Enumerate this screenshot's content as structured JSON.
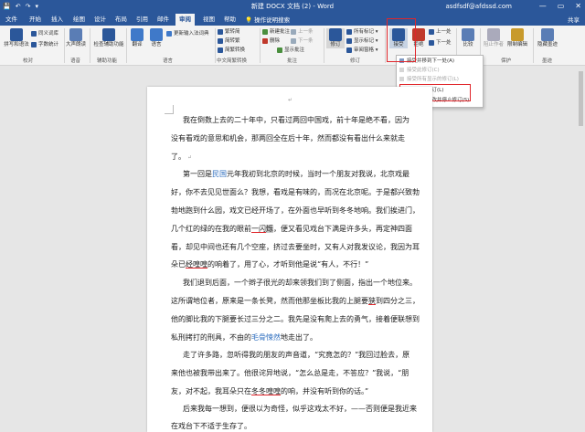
{
  "title_bar": {
    "quick_access": [
      "💾",
      "↶",
      "↷",
      "▾"
    ],
    "doc_title": "新建 DOCX 文档 (2) - Word",
    "user": "asdfsdf@afdssd.com",
    "minimize": "—",
    "restore": "▭",
    "close": "✕"
  },
  "tabs": [
    "文件",
    "开始",
    "插入",
    "绘图",
    "设计",
    "布局",
    "引用",
    "邮件",
    "审阅",
    "视图",
    "帮助"
  ],
  "tell_me": "操作说明搜索",
  "share": "共享",
  "ribbon": {
    "proofing": {
      "spell": "拼写和语法",
      "thesaurus": "同义词库",
      "wordcount": "字数统计",
      "label": "校对"
    },
    "speech": {
      "read_aloud": "大声朗读",
      "label": "语音"
    },
    "accessibility": {
      "check": "检查辅助功能",
      "label": "辅助功能"
    },
    "language": {
      "translate": "翻译",
      "language": "语言",
      "update_ime": "更新输入法词典",
      "label": "语言"
    },
    "chinese": {
      "t2s": "繁转简",
      "s2t": "简转繁",
      "convert": "简繁转换",
      "label": "中文简繁转换"
    },
    "comments": {
      "new": "新建批注",
      "delete": "删除",
      "prev": "上一条",
      "next": "下一条",
      "show": "显示批注",
      "label": "批注"
    },
    "tracking": {
      "track": "修订",
      "all_markup": "所有标记",
      "show_markup": "显示标记",
      "pane": "审阅窗格",
      "label": "修订"
    },
    "changes": {
      "accept": "接受",
      "reject": "拒绝",
      "previous": "上一处",
      "next": "下一处"
    },
    "compare": {
      "compare": "比较",
      "label": "比较"
    },
    "protect": {
      "block": "阻止作者",
      "restrict": "限制编辑",
      "label": "保护"
    },
    "ink": {
      "hide": "隐藏墨迹",
      "label": "墨迹"
    }
  },
  "accept_menu": {
    "items": [
      "接受并移到下一处(A)",
      "接受此修订(C)",
      "接受所有显示的修订(L)",
      "接受所有修订(L)",
      "接受所有更改并停止修订(S)"
    ]
  },
  "document": {
    "lines": [
      {
        "segments": [
          {
            "t": "我在倒数上去的二十年中，只看过两回中国戏，前十年是绝不看，因为"
          }
        ]
      },
      {
        "segments": [
          {
            "t": "没有看戏的意思和机会，那两回全在后十年，然而都没有看出什么来就走"
          }
        ]
      },
      {
        "segments": [
          {
            "t": "了。"
          }
        ]
      },
      {
        "segments": [
          {
            "t": "第一回是"
          },
          {
            "t": "民国",
            "c": "blue"
          },
          {
            "t": "元年我初到北京的时候，当时一个朋友对我说，北京戏最"
          }
        ]
      },
      {
        "segments": [
          {
            "t": "好，你不去见见世面么？我想，看戏是有味的，而况在北京呢。于是都兴致勃"
          }
        ]
      },
      {
        "segments": [
          {
            "t": "勃地跑到什么园，戏文已经开场了，在外面也早听到冬冬地响。我们挨进门，"
          }
        ]
      },
      {
        "segments": [
          {
            "t": "几个红的绿的在我的眼前"
          },
          {
            "t": "一闪",
            "c": "red"
          },
          {
            "t": "烁",
            "c": "gray"
          },
          {
            "t": "，便又看见戏台下满是许多头，再定神四面"
          }
        ]
      },
      {
        "segments": [
          {
            "t": "看，却见中间也还有几个空座，挤过去要坐时，又有人对我发议论，我因为耳"
          }
        ]
      },
      {
        "segments": [
          {
            "t": "朵已"
          },
          {
            "t": "经喤喤",
            "c": "red"
          },
          {
            "t": "的响着了，用了心，才听到他是说“有人，不行！”"
          }
        ]
      },
      {
        "segments": [
          {
            "t": "我们退到后面，一个辫子很光的却来领我们到了侧面，指出一个地位来。"
          }
        ]
      },
      {
        "segments": [
          {
            "t": "这所谓地位者，原来是一条长凳，然而他那坐板比我的上腿要"
          },
          {
            "t": "狭",
            "c": "red"
          },
          {
            "t": "到四分之三，"
          }
        ]
      },
      {
        "segments": [
          {
            "t": "他的脚比我的下腿要长过三分之二。我先是没有爬上去的勇气，接着便联想到"
          }
        ]
      },
      {
        "segments": [
          {
            "t": "私刑拷打的刑具，不由的"
          },
          {
            "t": "毛骨悚然",
            "c": "blue"
          },
          {
            "t": "地走出了。"
          }
        ]
      },
      {
        "segments": [
          {
            "t": "走了许多路，忽听得我的朋友的声音道，“究竟怎的？”我回过脸去，原"
          }
        ]
      },
      {
        "segments": [
          {
            "t": "来他也被我带出来了。他很诧异地说，“怎么总是走，不答应？”我说，“朋"
          }
        ]
      },
      {
        "segments": [
          {
            "t": "友，对不起，我耳朵只在"
          },
          {
            "t": "冬冬喤喤",
            "c": "red"
          },
          {
            "t": "的响，并没有听到你的话。”"
          }
        ]
      },
      {
        "segments": [
          {
            "t": "后来我每一想到，便很以为奇怪，似乎这戏太不好，——否则便是我近来"
          }
        ]
      },
      {
        "segments": [
          {
            "t": "在戏台下不适于生存了。"
          }
        ]
      }
    ]
  }
}
